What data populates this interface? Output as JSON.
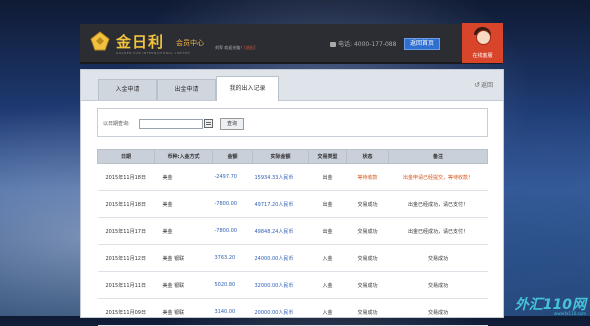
{
  "header": {
    "brand": "金日利",
    "brand_sub": "GOLDEN SUN INTERNATIONAL LIMITED",
    "member_center": "会员中心",
    "user_prefix": "刘军 欢迎光临！",
    "exit_label": "[退出]",
    "phone": "电话: 4000-177-088",
    "home_button": "返回首页",
    "service_label": "在线客服"
  },
  "tabs": [
    {
      "label": "入金申请",
      "active": false
    },
    {
      "label": "出金申请",
      "active": false
    },
    {
      "label": "我的出入记录",
      "active": true
    }
  ],
  "back_label": "返回",
  "search": {
    "label": "以日期查询:",
    "date_value": "",
    "button": "查询"
  },
  "table": {
    "columns": [
      "日期",
      "币种:入金方式",
      "金额",
      "实际金额",
      "交易类型",
      "状态",
      "备注"
    ],
    "rows": [
      [
        "2015年11月18日",
        "美金",
        "-2497.70",
        "15934.33人民币",
        "出金",
        "等待收款",
        "出金申请已经提交，等待收款！"
      ],
      [
        "2015年11月18日",
        "美金",
        "-7800.00",
        "49717.20人民币",
        "出金",
        "交易成功",
        "出金已经成功，请已支付！"
      ],
      [
        "2015年11月17日",
        "美金",
        "-7800.00",
        "49848.24人民币",
        "出金",
        "交易成功",
        "出金已经成功，请已支付！"
      ],
      [
        "2015年11月12日",
        "美金 银联",
        "3763.20",
        "24000.00人民币",
        "入金",
        "交易成功",
        "交易成功"
      ],
      [
        "2015年11月11日",
        "美金 银联",
        "5020.80",
        "32000.00人民币",
        "入金",
        "交易成功",
        "交易成功"
      ],
      [
        "2015年11月09日",
        "美金 银联",
        "3140.00",
        "20000.00人民币",
        "入金",
        "交易成功",
        "交易成功"
      ]
    ]
  },
  "watermark": {
    "text": "外汇110网",
    "url": "www.fx110.com"
  },
  "colors": {
    "brand": "#f2c23e",
    "pending": "#d4551a",
    "amount": "#2f5fb3",
    "service": "#d8452a"
  }
}
